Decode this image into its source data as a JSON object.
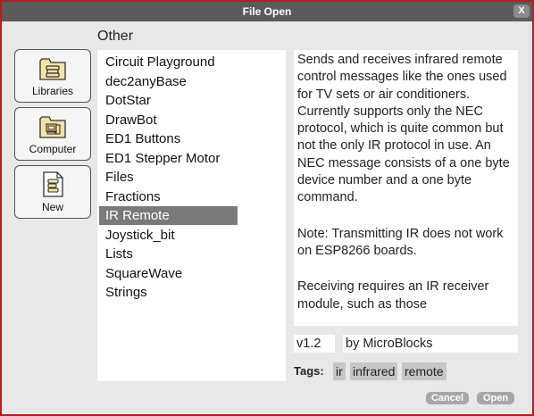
{
  "window": {
    "title": "File Open",
    "close_label": "X"
  },
  "folder_title": "Other",
  "sidebar": {
    "items": [
      {
        "label": "Libraries",
        "icon": "libraries-icon"
      },
      {
        "label": "Computer",
        "icon": "computer-icon"
      },
      {
        "label": "New",
        "icon": "new-icon"
      }
    ]
  },
  "files": {
    "items": [
      "Circuit Playground",
      "dec2anyBase",
      "DotStar",
      "DrawBot",
      "ED1 Buttons",
      "ED1 Stepper Motor",
      "Files",
      "Fractions",
      "IR Remote",
      "Joystick_bit",
      "Lists",
      "SquareWave",
      "Strings"
    ],
    "selected": "IR Remote"
  },
  "description": {
    "paragraphs": [
      "Sends and receives infrared remote control messages like the ones used for TV sets or air conditioners. Currently supports only the NEC protocol, which is quite common but not the only IR protocol in use. An NEC message consists of a one byte device number and a one byte command.",
      "Note: Transmitting IR does not work on ESP8266 boards.",
      "Receiving requires an IR receiver module, such as those"
    ]
  },
  "library": {
    "version": "v1.2",
    "author": "by MicroBlocks"
  },
  "tags": {
    "label": "Tags:",
    "items": [
      "ir",
      "infrared",
      "remote"
    ]
  },
  "buttons": {
    "cancel": "Cancel",
    "open": "Open"
  },
  "colors": {
    "titlebar": "#5b5b5b",
    "window_border": "#b02020",
    "selection": "#7a7a7a",
    "tag_bg": "#c6c6c6",
    "button_bg": "#a7a7a7"
  }
}
